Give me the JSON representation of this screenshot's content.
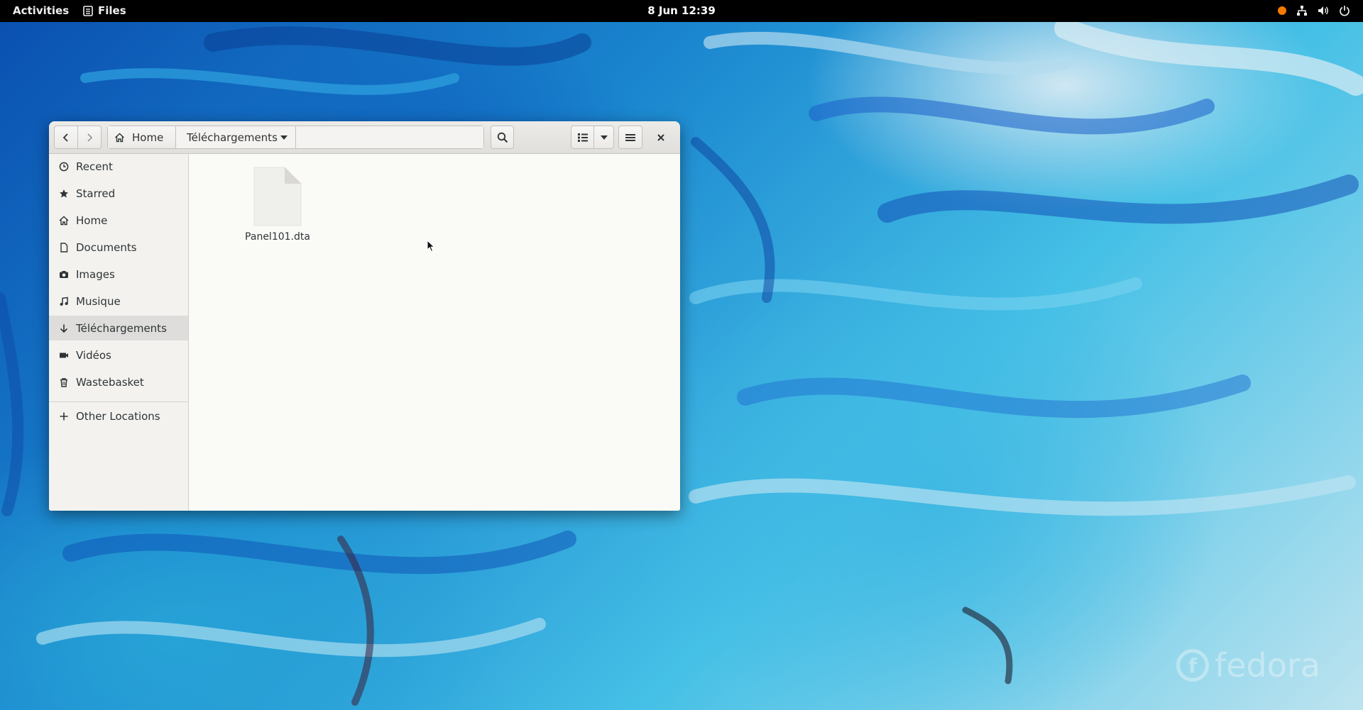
{
  "topbar": {
    "activities": "Activities",
    "app_name": "Files",
    "clock": "8 Jun  12:39",
    "tray_icons": [
      "notification-dot-icon",
      "network-icon",
      "volume-icon",
      "power-icon"
    ]
  },
  "window": {
    "pathbar": {
      "home_label": "Home",
      "current_label": "Téléchargements"
    },
    "sidebar": {
      "items": [
        {
          "label": "Recent",
          "icon": "clock-icon"
        },
        {
          "label": "Starred",
          "icon": "star-icon"
        },
        {
          "label": "Home",
          "icon": "home-icon"
        },
        {
          "label": "Documents",
          "icon": "document-icon"
        },
        {
          "label": "Images",
          "icon": "camera-icon"
        },
        {
          "label": "Musique",
          "icon": "music-icon"
        },
        {
          "label": "Téléchargements",
          "icon": "download-icon",
          "active": true
        },
        {
          "label": "Vidéos",
          "icon": "video-icon"
        },
        {
          "label": "Wastebasket",
          "icon": "trash-icon"
        }
      ],
      "other_locations": "Other Locations"
    },
    "files": [
      {
        "name": "Panel101.dta",
        "icon": "generic-file-icon"
      }
    ]
  },
  "desktop": {
    "watermark": "fedora"
  },
  "colors": {
    "topbar_bg": "#000000",
    "accent_tray": "#f57900",
    "sidebar_active": "#dedddb"
  }
}
